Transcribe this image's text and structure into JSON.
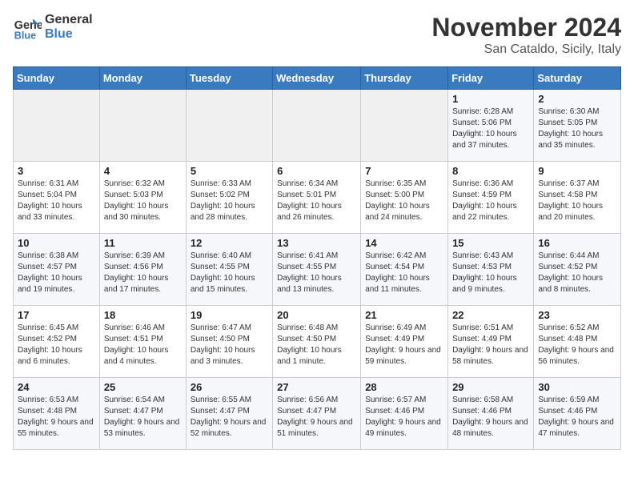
{
  "header": {
    "logo_line1": "General",
    "logo_line2": "Blue",
    "month_title": "November 2024",
    "location": "San Cataldo, Sicily, Italy"
  },
  "weekdays": [
    "Sunday",
    "Monday",
    "Tuesday",
    "Wednesday",
    "Thursday",
    "Friday",
    "Saturday"
  ],
  "weeks": [
    [
      {
        "day": "",
        "info": ""
      },
      {
        "day": "",
        "info": ""
      },
      {
        "day": "",
        "info": ""
      },
      {
        "day": "",
        "info": ""
      },
      {
        "day": "",
        "info": ""
      },
      {
        "day": "1",
        "info": "Sunrise: 6:28 AM\nSunset: 5:06 PM\nDaylight: 10 hours and 37 minutes."
      },
      {
        "day": "2",
        "info": "Sunrise: 6:30 AM\nSunset: 5:05 PM\nDaylight: 10 hours and 35 minutes."
      }
    ],
    [
      {
        "day": "3",
        "info": "Sunrise: 6:31 AM\nSunset: 5:04 PM\nDaylight: 10 hours and 33 minutes."
      },
      {
        "day": "4",
        "info": "Sunrise: 6:32 AM\nSunset: 5:03 PM\nDaylight: 10 hours and 30 minutes."
      },
      {
        "day": "5",
        "info": "Sunrise: 6:33 AM\nSunset: 5:02 PM\nDaylight: 10 hours and 28 minutes."
      },
      {
        "day": "6",
        "info": "Sunrise: 6:34 AM\nSunset: 5:01 PM\nDaylight: 10 hours and 26 minutes."
      },
      {
        "day": "7",
        "info": "Sunrise: 6:35 AM\nSunset: 5:00 PM\nDaylight: 10 hours and 24 minutes."
      },
      {
        "day": "8",
        "info": "Sunrise: 6:36 AM\nSunset: 4:59 PM\nDaylight: 10 hours and 22 minutes."
      },
      {
        "day": "9",
        "info": "Sunrise: 6:37 AM\nSunset: 4:58 PM\nDaylight: 10 hours and 20 minutes."
      }
    ],
    [
      {
        "day": "10",
        "info": "Sunrise: 6:38 AM\nSunset: 4:57 PM\nDaylight: 10 hours and 19 minutes."
      },
      {
        "day": "11",
        "info": "Sunrise: 6:39 AM\nSunset: 4:56 PM\nDaylight: 10 hours and 17 minutes."
      },
      {
        "day": "12",
        "info": "Sunrise: 6:40 AM\nSunset: 4:55 PM\nDaylight: 10 hours and 15 minutes."
      },
      {
        "day": "13",
        "info": "Sunrise: 6:41 AM\nSunset: 4:55 PM\nDaylight: 10 hours and 13 minutes."
      },
      {
        "day": "14",
        "info": "Sunrise: 6:42 AM\nSunset: 4:54 PM\nDaylight: 10 hours and 11 minutes."
      },
      {
        "day": "15",
        "info": "Sunrise: 6:43 AM\nSunset: 4:53 PM\nDaylight: 10 hours and 9 minutes."
      },
      {
        "day": "16",
        "info": "Sunrise: 6:44 AM\nSunset: 4:52 PM\nDaylight: 10 hours and 8 minutes."
      }
    ],
    [
      {
        "day": "17",
        "info": "Sunrise: 6:45 AM\nSunset: 4:52 PM\nDaylight: 10 hours and 6 minutes."
      },
      {
        "day": "18",
        "info": "Sunrise: 6:46 AM\nSunset: 4:51 PM\nDaylight: 10 hours and 4 minutes."
      },
      {
        "day": "19",
        "info": "Sunrise: 6:47 AM\nSunset: 4:50 PM\nDaylight: 10 hours and 3 minutes."
      },
      {
        "day": "20",
        "info": "Sunrise: 6:48 AM\nSunset: 4:50 PM\nDaylight: 10 hours and 1 minute."
      },
      {
        "day": "21",
        "info": "Sunrise: 6:49 AM\nSunset: 4:49 PM\nDaylight: 9 hours and 59 minutes."
      },
      {
        "day": "22",
        "info": "Sunrise: 6:51 AM\nSunset: 4:49 PM\nDaylight: 9 hours and 58 minutes."
      },
      {
        "day": "23",
        "info": "Sunrise: 6:52 AM\nSunset: 4:48 PM\nDaylight: 9 hours and 56 minutes."
      }
    ],
    [
      {
        "day": "24",
        "info": "Sunrise: 6:53 AM\nSunset: 4:48 PM\nDaylight: 9 hours and 55 minutes."
      },
      {
        "day": "25",
        "info": "Sunrise: 6:54 AM\nSunset: 4:47 PM\nDaylight: 9 hours and 53 minutes."
      },
      {
        "day": "26",
        "info": "Sunrise: 6:55 AM\nSunset: 4:47 PM\nDaylight: 9 hours and 52 minutes."
      },
      {
        "day": "27",
        "info": "Sunrise: 6:56 AM\nSunset: 4:47 PM\nDaylight: 9 hours and 51 minutes."
      },
      {
        "day": "28",
        "info": "Sunrise: 6:57 AM\nSunset: 4:46 PM\nDaylight: 9 hours and 49 minutes."
      },
      {
        "day": "29",
        "info": "Sunrise: 6:58 AM\nSunset: 4:46 PM\nDaylight: 9 hours and 48 minutes."
      },
      {
        "day": "30",
        "info": "Sunrise: 6:59 AM\nSunset: 4:46 PM\nDaylight: 9 hours and 47 minutes."
      }
    ]
  ]
}
